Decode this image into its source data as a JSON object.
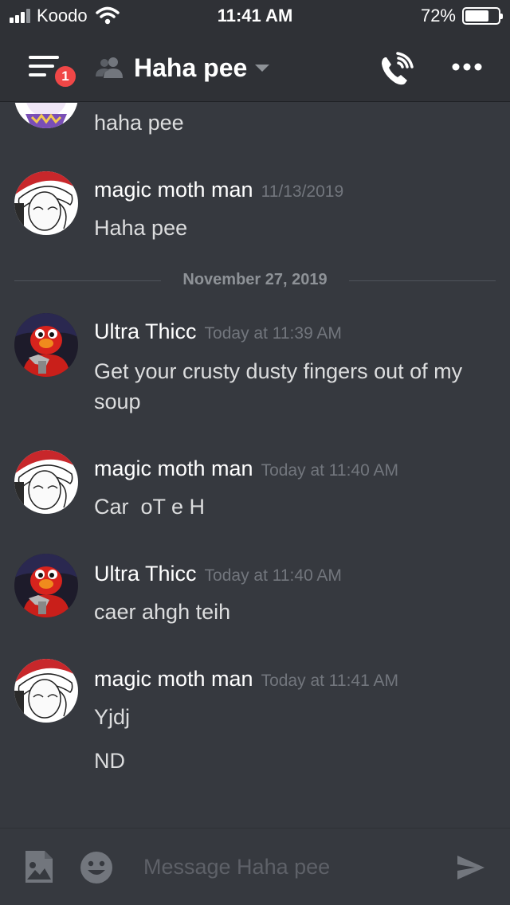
{
  "status_bar": {
    "carrier": "Koodo",
    "time": "11:41 AM",
    "battery": "72%",
    "battery_level": 0.72
  },
  "header": {
    "channel_name": "Haha pee",
    "unread_badge": "1",
    "icons": [
      "menu-icon",
      "group-icon",
      "chevron-down-icon",
      "call-icon",
      "more-icon"
    ]
  },
  "messages": {
    "m0": {
      "text": "haha pee"
    },
    "m1": {
      "author": "magic moth man",
      "timestamp": "11/13/2019",
      "text": "Haha pee"
    },
    "divider": "November 27, 2019",
    "m2": {
      "author": "Ultra Thicc",
      "timestamp": "Today at 11:39 AM",
      "text": "Get your crusty dusty fingers out of my soup"
    },
    "m3": {
      "author": "magic moth man",
      "timestamp": "Today at 11:40 AM",
      "text": "Car  oT e H"
    },
    "m4": {
      "author": "Ultra Thicc",
      "timestamp": "Today at 11:40 AM",
      "text": "caer ahgh teih"
    },
    "m5": {
      "author": "magic moth man",
      "timestamp": "Today at 11:41 AM",
      "text": "Yjdj",
      "text2": "ND"
    }
  },
  "composer": {
    "placeholder": "Message Haha pee",
    "icons": [
      "image-icon",
      "emoji-icon",
      "send-icon"
    ]
  },
  "colors": {
    "background": "#36393f",
    "header_bg": "#2f3136",
    "badge": "#f04747",
    "username": "#ffffff",
    "text": "#dcddde",
    "muted": "#72767d"
  }
}
